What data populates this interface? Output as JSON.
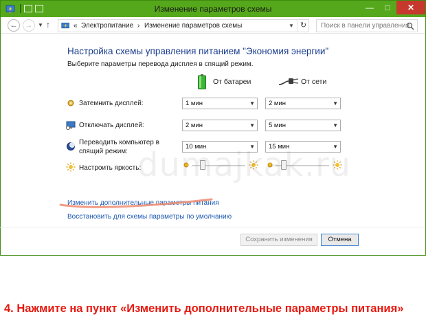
{
  "window": {
    "title": "Изменение параметров схемы"
  },
  "addressbar": {
    "breadcrumb_prefix": "«",
    "crumbs": [
      "Электропитание",
      "Изменение параметров схемы"
    ],
    "separator": "›",
    "search_placeholder": "Поиск в панели управления"
  },
  "content": {
    "heading": "Настройка схемы управления питанием \"Экономия энергии\"",
    "subheading": "Выберите параметры перевода дисплея в спящий режим.",
    "columns": {
      "battery": "От батареи",
      "ac": "От сети"
    },
    "rows": [
      {
        "label": "Затемнить дисплей:",
        "battery": "1 мин",
        "ac": "2 мин"
      },
      {
        "label": "Отключать дисплей:",
        "battery": "2 мин",
        "ac": "5 мин"
      },
      {
        "label": "Переводить компьютер в спящий режим:",
        "battery": "10 мин",
        "ac": "15 мин"
      }
    ],
    "brightness": {
      "label": "Настроить яркость:",
      "battery_level": 0.2,
      "ac_level": 0.15
    },
    "watermark": "dumajkak.ru",
    "links": {
      "advanced": "Изменить дополнительные параметры питания",
      "restore": "Восстановить для схемы параметры по умолчанию"
    },
    "buttons": {
      "save": "Сохранить изменения",
      "cancel": "Отмена"
    }
  },
  "caption": "4. Нажмите на пункт «Изменить дополнительные параметры питания»",
  "colors": {
    "titlebar": "#55a81b",
    "heading": "#1c3f8f",
    "link": "#1a56b0",
    "caption": "#e8190f",
    "highlight_stroke": "#f08a70"
  }
}
